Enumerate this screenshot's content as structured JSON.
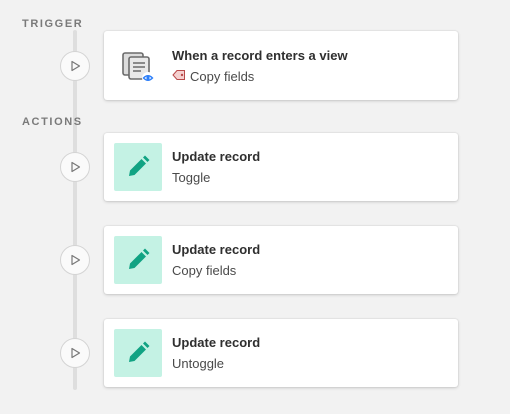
{
  "sections": {
    "trigger_label": "TRIGGER",
    "actions_label": "ACTIONS"
  },
  "trigger": {
    "title": "When a record enters a view",
    "subtitle": "Copy fields",
    "icon": "record-view-icon",
    "tag_icon": "tag-icon"
  },
  "actions": [
    {
      "title": "Update record",
      "subtitle": "Toggle",
      "icon": "pencil-icon"
    },
    {
      "title": "Update record",
      "subtitle": "Copy fields",
      "icon": "pencil-icon"
    },
    {
      "title": "Update record",
      "subtitle": "Untoggle",
      "icon": "pencil-icon"
    }
  ],
  "colors": {
    "action_icon_bg": "#c4f2e4",
    "action_icon_fg": "#11a383",
    "eye_badge": "#2d7ff9",
    "background": "#f2f2f2"
  }
}
